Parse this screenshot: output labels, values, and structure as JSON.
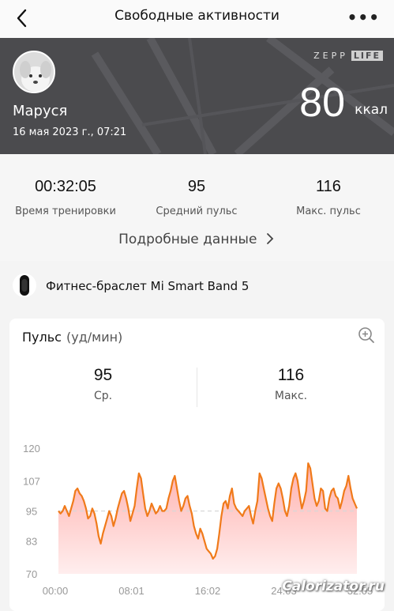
{
  "header": {
    "title": "Свободные активности",
    "back_icon": "chevron-left-icon",
    "more_icon": "more-dots-icon"
  },
  "hero": {
    "username": "Маруся",
    "datetime": "16 мая 2023 г., 07:21",
    "brand_zepp": "ZEPP",
    "brand_life": "LIFE",
    "calories_value": "80",
    "calories_unit": "ккал"
  },
  "summary": {
    "items": [
      {
        "value": "00:32:05",
        "label": "Время тренировки"
      },
      {
        "value": "95",
        "label": "Средний пульс"
      },
      {
        "value": "116",
        "label": "Макс. пульс"
      }
    ],
    "details_link": "Подробные данные"
  },
  "device": {
    "label": "Фитнес-браслет Mi Smart Band 5",
    "icon": "fitness-band-icon"
  },
  "heart_rate": {
    "title": "Пульс",
    "unit": "(уд/мин)",
    "avg_value": "95",
    "avg_label": "Ср.",
    "max_value": "116",
    "max_label": "Макс.",
    "zoom_icon": "zoom-in-icon"
  },
  "chart_data": {
    "type": "area",
    "x_ticks": [
      "00:00",
      "08:01",
      "16:02",
      "24:03",
      "32:05"
    ],
    "y_ticks": [
      120,
      107,
      95,
      83,
      70
    ],
    "ylim": [
      70,
      120
    ],
    "avg_line": 95,
    "colors": {
      "line": "#f07a1a",
      "fill_top": "#ffb0ad",
      "fill_bottom": "#ffeeee",
      "avg": "#d8d8d8"
    },
    "series": [
      {
        "values": [
          95,
          94,
          95,
          97,
          95,
          93,
          96,
          99,
          103,
          104,
          102,
          101,
          99,
          96,
          92,
          93,
          96,
          94,
          90,
          85,
          82,
          86,
          89,
          92,
          95,
          93,
          89,
          92,
          96,
          99,
          102,
          103,
          100,
          96,
          91,
          94,
          97,
          104,
          110,
          108,
          102,
          96,
          93,
          95,
          98,
          96,
          94,
          95,
          97,
          95,
          95,
          96,
          100,
          103,
          107,
          109,
          104,
          99,
          95,
          97,
          100,
          101,
          97,
          94,
          89,
          86,
          84,
          88,
          86,
          83,
          80,
          79,
          78,
          76,
          77,
          80,
          86,
          93,
          98,
          99,
          96,
          101,
          104,
          98,
          96,
          95,
          94,
          93,
          95,
          96,
          97,
          93,
          90,
          95,
          99,
          110,
          108,
          104,
          100,
          96,
          93,
          91,
          98,
          104,
          106,
          104,
          100,
          95,
          93,
          97,
          104,
          108,
          110,
          107,
          101,
          96,
          99,
          103,
          114,
          112,
          106,
          100,
          97,
          99,
          104,
          103,
          96,
          95,
          100,
          103,
          104,
          101,
          100,
          96,
          99,
          103,
          105,
          109,
          104,
          100,
          98,
          96
        ]
      }
    ]
  },
  "watermark": "Calorizator.ru"
}
